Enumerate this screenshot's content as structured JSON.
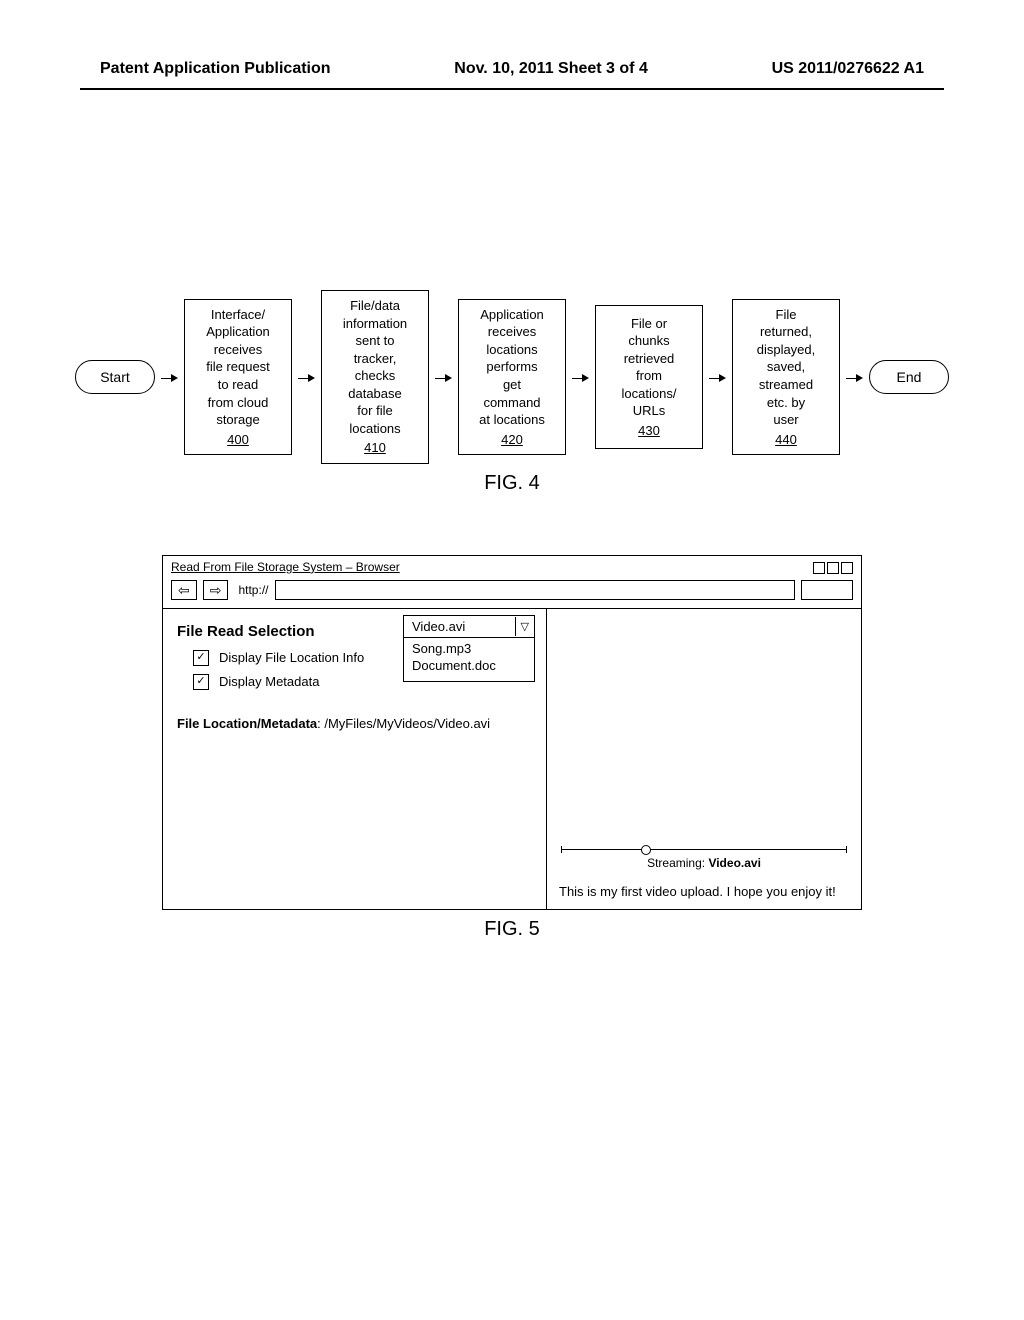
{
  "header": {
    "left": "Patent Application Publication",
    "center": "Nov. 10, 2011  Sheet 3 of 4",
    "right": "US 2011/0276622 A1"
  },
  "flow": {
    "start": "Start",
    "end": "End",
    "boxes": [
      {
        "text": "Interface/\nApplication\nreceives\nfile request\nto read\nfrom cloud\nstorage",
        "ref": "400"
      },
      {
        "text": "File/data\ninformation\nsent to\ntracker,\nchecks\ndatabase\nfor file\nlocations",
        "ref": "410"
      },
      {
        "text": "Application\nreceives\nlocations\nperforms\nget\ncommand\nat locations",
        "ref": "420"
      },
      {
        "text": "File or\nchunks\nretrieved\nfrom\nlocations/\nURLs",
        "ref": "430"
      },
      {
        "text": "File\nreturned,\ndisplayed,\nsaved,\nstreamed\netc. by\nuser",
        "ref": "440"
      }
    ],
    "fig_label": "FIG. 4"
  },
  "browser": {
    "title": "Read From File Storage System – Browser",
    "proto": "http://",
    "nav_back": "⇦",
    "nav_fwd": "⇨",
    "heading": "File Read Selection",
    "checks": [
      {
        "label": "Display File Location Info",
        "checked": "✓"
      },
      {
        "label": "Display Metadata",
        "checked": "✓"
      }
    ],
    "dropdown": {
      "selected": "Video.avi",
      "tri": "▽",
      "options": [
        "Song.mp3",
        "Document.doc"
      ]
    },
    "meta": {
      "label": "File Location/Metadata",
      "value": ": /MyFiles/MyVideos/Video.avi"
    },
    "stream": {
      "prefix": "Streaming: ",
      "file": "Video.avi"
    },
    "desc": "This is my first video upload. I hope you enjoy it!",
    "fig_label": "FIG. 5"
  }
}
